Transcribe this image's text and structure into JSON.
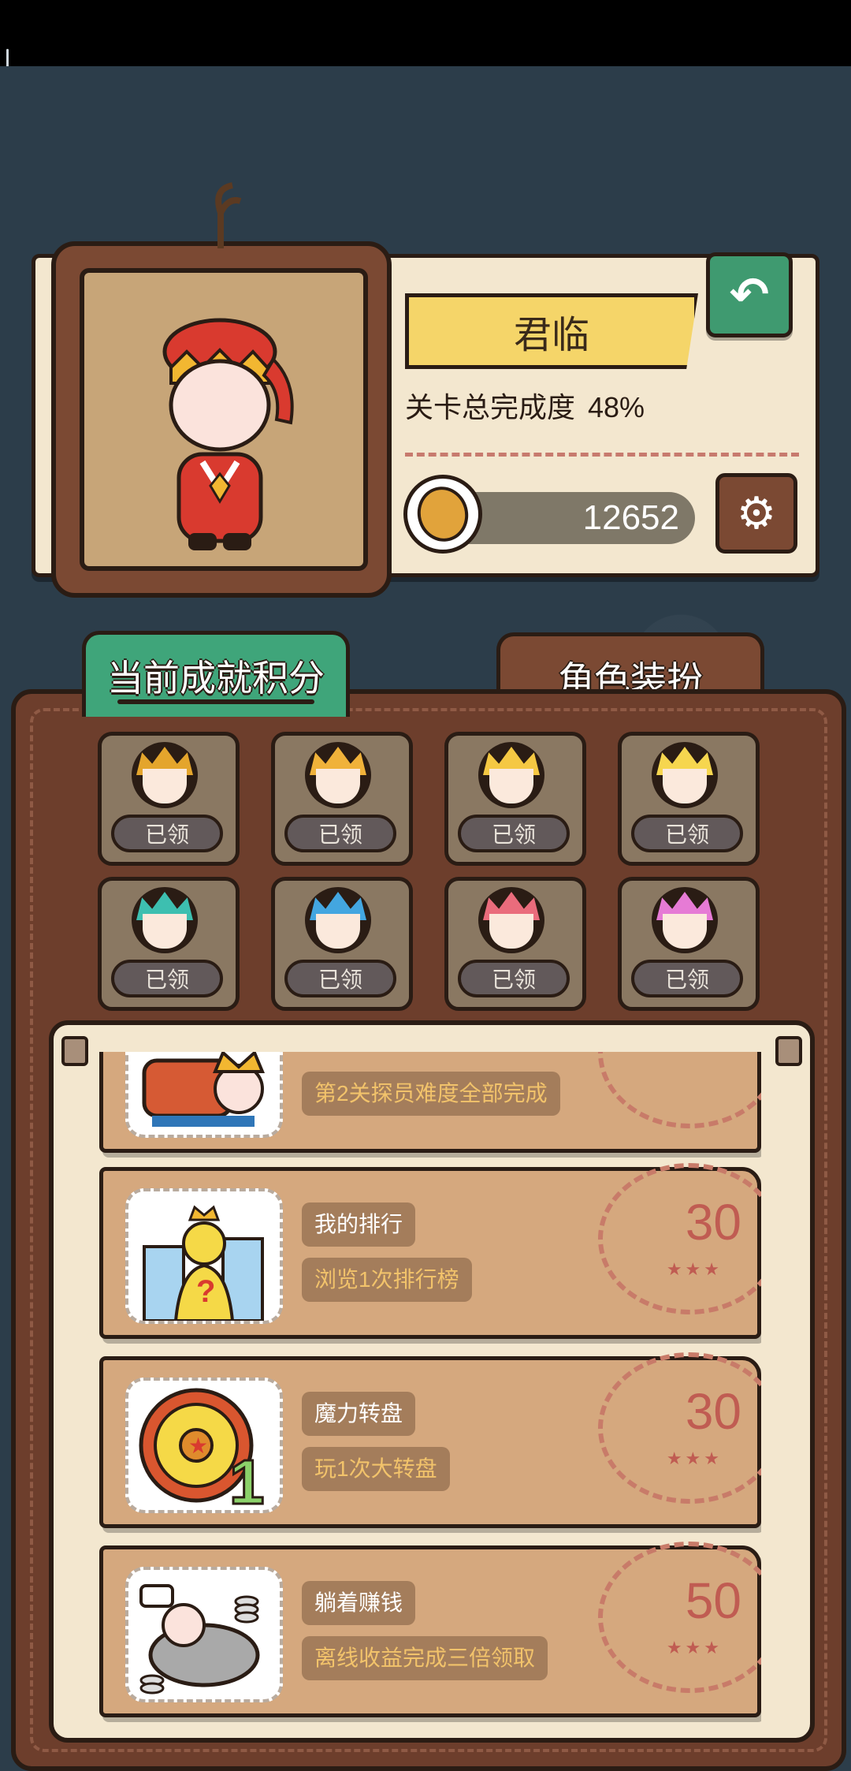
{
  "colors": {
    "accent_green": "#3fa57a",
    "brown": "#7b4933",
    "paper": "#f3e7cf",
    "stamp_red": "#c05c52"
  },
  "profile": {
    "name": "君临",
    "progress_label": "关卡总完成度",
    "progress_value": "48%",
    "coins": "12652"
  },
  "header_buttons": {
    "back_icon": "back-arrow-icon",
    "settings_icon": "gear-icon"
  },
  "tabs": [
    {
      "label": "当前成就积分"
    },
    {
      "label": "角色装扮"
    }
  ],
  "badges": [
    {
      "status": "已领",
      "crown": "#e4a52c"
    },
    {
      "status": "已领",
      "crown": "#f0b23a"
    },
    {
      "status": "已领",
      "crown": "#f5c843"
    },
    {
      "status": "已领",
      "crown": "#f6d64f"
    },
    {
      "status": "已领",
      "crown": "#3dbfb0"
    },
    {
      "status": "已领",
      "crown": "#43a6e0"
    },
    {
      "status": "已领",
      "crown": "#ea6c7c"
    },
    {
      "status": "已领",
      "crown": "#e67bd5"
    }
  ],
  "tasks": [
    {
      "title": "",
      "desc": "第2关探员难度全部完成",
      "points": ""
    },
    {
      "title": "我的排行",
      "desc": "浏览1次排行榜",
      "points": "30"
    },
    {
      "title": "魔力转盘",
      "desc": "玩1次大转盘",
      "points": "30"
    },
    {
      "title": "躺着赚钱",
      "desc": "离线收益完成三倍领取",
      "points": "50"
    }
  ]
}
